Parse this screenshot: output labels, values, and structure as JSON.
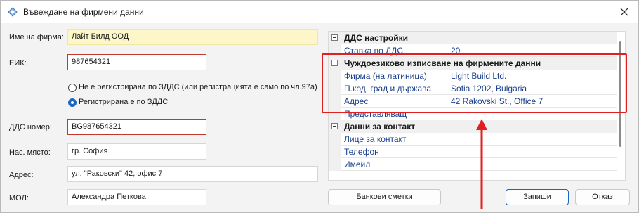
{
  "window": {
    "title": "Въвеждане на фирмени данни"
  },
  "labels": {
    "company_name": "Име на фирма:",
    "eik": "ЕИК:",
    "vat_number": "ДДС номер:",
    "city": "Нас. място:",
    "address": "Адрес:",
    "manager": "МОЛ:"
  },
  "fields": {
    "company_name": "Лайт Билд ООД",
    "eik": "987654321",
    "vat_number": "BG987654321",
    "city": "гр. София",
    "address": "ул. \"Раковски\" 42, офис 7",
    "manager": "Александра Петкова"
  },
  "radios": [
    {
      "label": "Не е регистрирана по ЗДДС (или регистрацията е само по чл.97а)",
      "selected": false
    },
    {
      "label": "Регистрирана е по ЗДДС",
      "selected": true
    }
  ],
  "grid": {
    "vat_section": {
      "title": "ДДС настройки",
      "rows": [
        {
          "key": "Ставка по ДДС",
          "value": "20"
        }
      ]
    },
    "foreign_section": {
      "title": "Чуждоезиково изписване на фирмените данни",
      "rows": [
        {
          "key": "Фирма (на латиница)",
          "value": "Light Build Ltd."
        },
        {
          "key": "П.код, град и държава",
          "value": "Sofia 1202, Bulgaria"
        },
        {
          "key": "Адрес",
          "value": "42 Rakovski St., Office 7"
        },
        {
          "key": "Представляващ",
          "value": ""
        }
      ]
    },
    "contact_section": {
      "title": "Данни за контакт",
      "rows": [
        {
          "key": "Лице за контакт",
          "value": ""
        },
        {
          "key": "Телефон",
          "value": ""
        },
        {
          "key": "Имейл",
          "value": ""
        }
      ]
    }
  },
  "buttons": {
    "bank_accounts": "Банкови сметки",
    "save": "Запиши",
    "cancel": "Отказ"
  },
  "colors": {
    "error_border": "#c0392b",
    "highlight_fill": "#fdf6c8",
    "accent": "#1a66c2",
    "annotation": "#e02020"
  }
}
